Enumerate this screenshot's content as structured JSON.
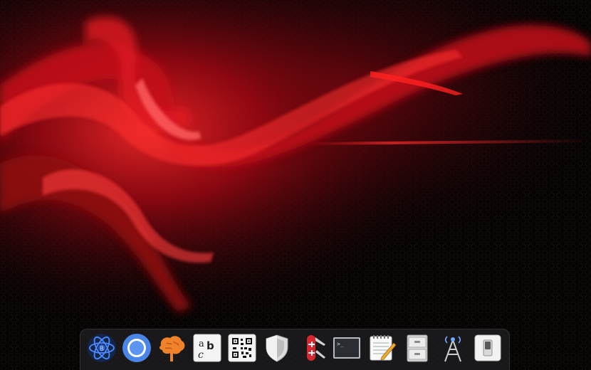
{
  "desktop": {
    "wallpaper": {
      "name": "red-abstract-wallpaper",
      "colors": {
        "base": "#060303",
        "accent": "#e01020",
        "highlight": "#ff4a4a"
      }
    }
  },
  "dock": {
    "apps": [
      {
        "id": "atom",
        "icon": "atom-editor-icon"
      },
      {
        "id": "chromium",
        "icon": "chromium-browser-icon"
      },
      {
        "id": "brain",
        "icon": "brain-tree-icon"
      },
      {
        "id": "font-viewer",
        "icon": "font-viewer-icon",
        "glyphs": [
          "a",
          "b",
          "c"
        ]
      },
      {
        "id": "qr-code",
        "icon": "qr-code-icon"
      },
      {
        "id": "shield",
        "icon": "shield-icon"
      },
      {
        "id": "swiss-knife",
        "icon": "swiss-army-knife-icon"
      },
      {
        "id": "terminal",
        "icon": "terminal-icon",
        "prompt": ">_"
      },
      {
        "id": "text-editor",
        "icon": "notepad-pencil-icon"
      },
      {
        "id": "file-cabinet",
        "icon": "file-cabinet-icon"
      },
      {
        "id": "network-tower",
        "icon": "network-tower-icon"
      },
      {
        "id": "toggle-switch",
        "icon": "toggle-switch-icon"
      }
    ]
  }
}
